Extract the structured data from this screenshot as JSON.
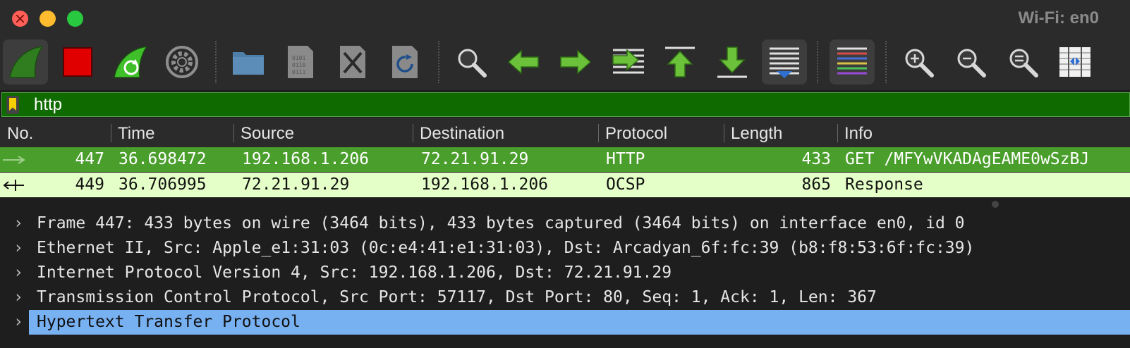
{
  "window": {
    "title": "Wi-Fi: en0"
  },
  "toolbar": {
    "buttons": [
      {
        "icon": "start-capture-icon"
      },
      {
        "icon": "stop-capture-icon"
      },
      {
        "icon": "restart-capture-icon"
      },
      {
        "icon": "capture-options-icon"
      },
      {
        "icon": "open-file-icon"
      },
      {
        "icon": "save-file-icon"
      },
      {
        "icon": "close-file-icon"
      },
      {
        "icon": "reload-file-icon"
      },
      {
        "icon": "find-packet-icon"
      },
      {
        "icon": "go-back-icon"
      },
      {
        "icon": "go-forward-icon"
      },
      {
        "icon": "go-to-packet-icon"
      },
      {
        "icon": "go-first-icon"
      },
      {
        "icon": "go-last-icon"
      },
      {
        "icon": "autoscroll-icon"
      },
      {
        "icon": "colorize-icon"
      },
      {
        "icon": "zoom-in-icon"
      },
      {
        "icon": "zoom-out-icon"
      },
      {
        "icon": "zoom-normal-icon"
      },
      {
        "icon": "resize-columns-icon"
      }
    ]
  },
  "filter": {
    "value": "http"
  },
  "packet_list": {
    "columns": [
      "No.",
      "Time",
      "Source",
      "Destination",
      "Protocol",
      "Length",
      "Info"
    ],
    "rows": [
      {
        "no": "447",
        "time": "36.698472",
        "source": "192.168.1.206",
        "destination": "72.21.91.29",
        "protocol": "HTTP",
        "length": "433",
        "info": "GET /MFYwVKADAgEAME0wSzBJ",
        "selected": true
      },
      {
        "no": "449",
        "time": "36.706995",
        "source": "72.21.91.29",
        "destination": "192.168.1.206",
        "protocol": "OCSP",
        "length": "865",
        "info": "Response",
        "selected": false
      }
    ]
  },
  "details": {
    "items": [
      {
        "text": "Frame 447: 433 bytes on wire (3464 bits), 433 bytes captured (3464 bits) on interface en0, id 0"
      },
      {
        "text": "Ethernet II, Src: Apple_e1:31:03 (0c:e4:41:e1:31:03), Dst: Arcadyan_6f:fc:39 (b8:f8:53:6f:fc:39)"
      },
      {
        "text": "Internet Protocol Version 4, Src: 192.168.1.206, Dst: 72.21.91.29"
      },
      {
        "text": "Transmission Control Protocol, Src Port: 57117, Dst Port: 80, Seq: 1, Ack: 1, Len: 367"
      },
      {
        "text": "Hypertext Transfer Protocol"
      }
    ],
    "chevron": "›"
  },
  "colors": {
    "filter_bg": "#0f6b00",
    "row_selected": "#4a9e2c",
    "row_ocsp": "#e4ffc7",
    "detail_selected": "#78b1f2"
  }
}
